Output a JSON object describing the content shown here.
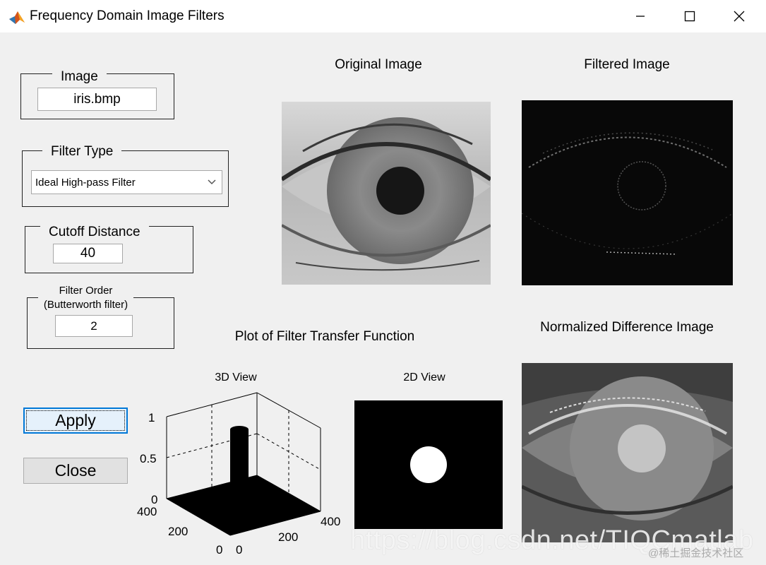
{
  "window": {
    "title": "Frequency Domain Image Filters"
  },
  "controls": {
    "image": {
      "group_label": "Image",
      "value": "iris.bmp"
    },
    "filter_type": {
      "group_label": "Filter Type",
      "selected": "Ideal High-pass Filter"
    },
    "cutoff": {
      "group_label": "Cutoff Distance",
      "value": "40"
    },
    "order": {
      "group_label_line1": "Filter Order",
      "group_label_line2": "(Butterworth filter)",
      "value": "2"
    },
    "apply_label": "Apply",
    "close_label": "Close"
  },
  "panels": {
    "original_title": "Original Image",
    "filtered_title": "Filtered Image",
    "difference_title": "Normalized Difference Image",
    "transfer_title": "Plot of Filter Transfer Function",
    "view3d_title": "3D View",
    "view2d_title": "2D View"
  },
  "plot3d": {
    "z_ticks": [
      "1",
      "0.5",
      "0"
    ],
    "y_ticks": [
      "400",
      "200",
      "0"
    ],
    "x_ticks": [
      "0",
      "200",
      "400"
    ]
  },
  "watermark": {
    "main": "https://blog.csdn.net/TIQCmatlab",
    "sub": "@稀土掘金技术社区"
  },
  "colors": {
    "title_bar": "#ffffff",
    "client_bg": "#f0f0f0",
    "focus_blue": "#0078d7"
  }
}
